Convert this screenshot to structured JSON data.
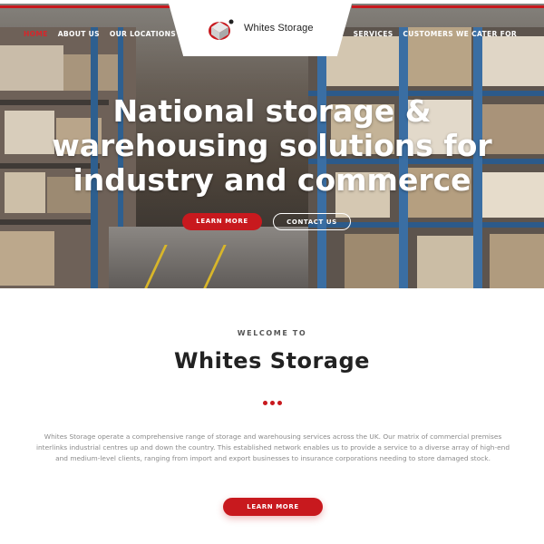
{
  "nav": {
    "left": [
      {
        "label": "HOME",
        "active": true
      },
      {
        "label": "ABOUT US",
        "active": false
      },
      {
        "label": "OUR LOCATIONS",
        "active": false
      }
    ],
    "right": [
      {
        "label": "SERVICES"
      },
      {
        "label": "CUSTOMERS WE CATER FOR"
      }
    ]
  },
  "logo": {
    "text": "Whites Storage",
    "icon": "logo-mark-icon"
  },
  "hero": {
    "title_lines": [
      "National storage &",
      "warehousing solutions for",
      "industry and commerce"
    ],
    "learn_more": "LEARN MORE",
    "contact_us": "CONTACT US"
  },
  "welcome": {
    "kicker": "WELCOME TO",
    "title": "Whites Storage",
    "body": "Whites Storage operate a comprehensive range of storage and warehousing services across the UK.  Our matrix of commercial premises interlinks industrial centres up and down the country.  This established network enables us to provide a service to a diverse array of high-end and medium-level clients, ranging from import and export businesses to insurance corporations needing to store damaged stock.",
    "learn_more": "LEARN MORE"
  },
  "colors": {
    "accent": "#c8191e",
    "text_dark": "#222222",
    "text_muted": "#8a8a8a"
  }
}
